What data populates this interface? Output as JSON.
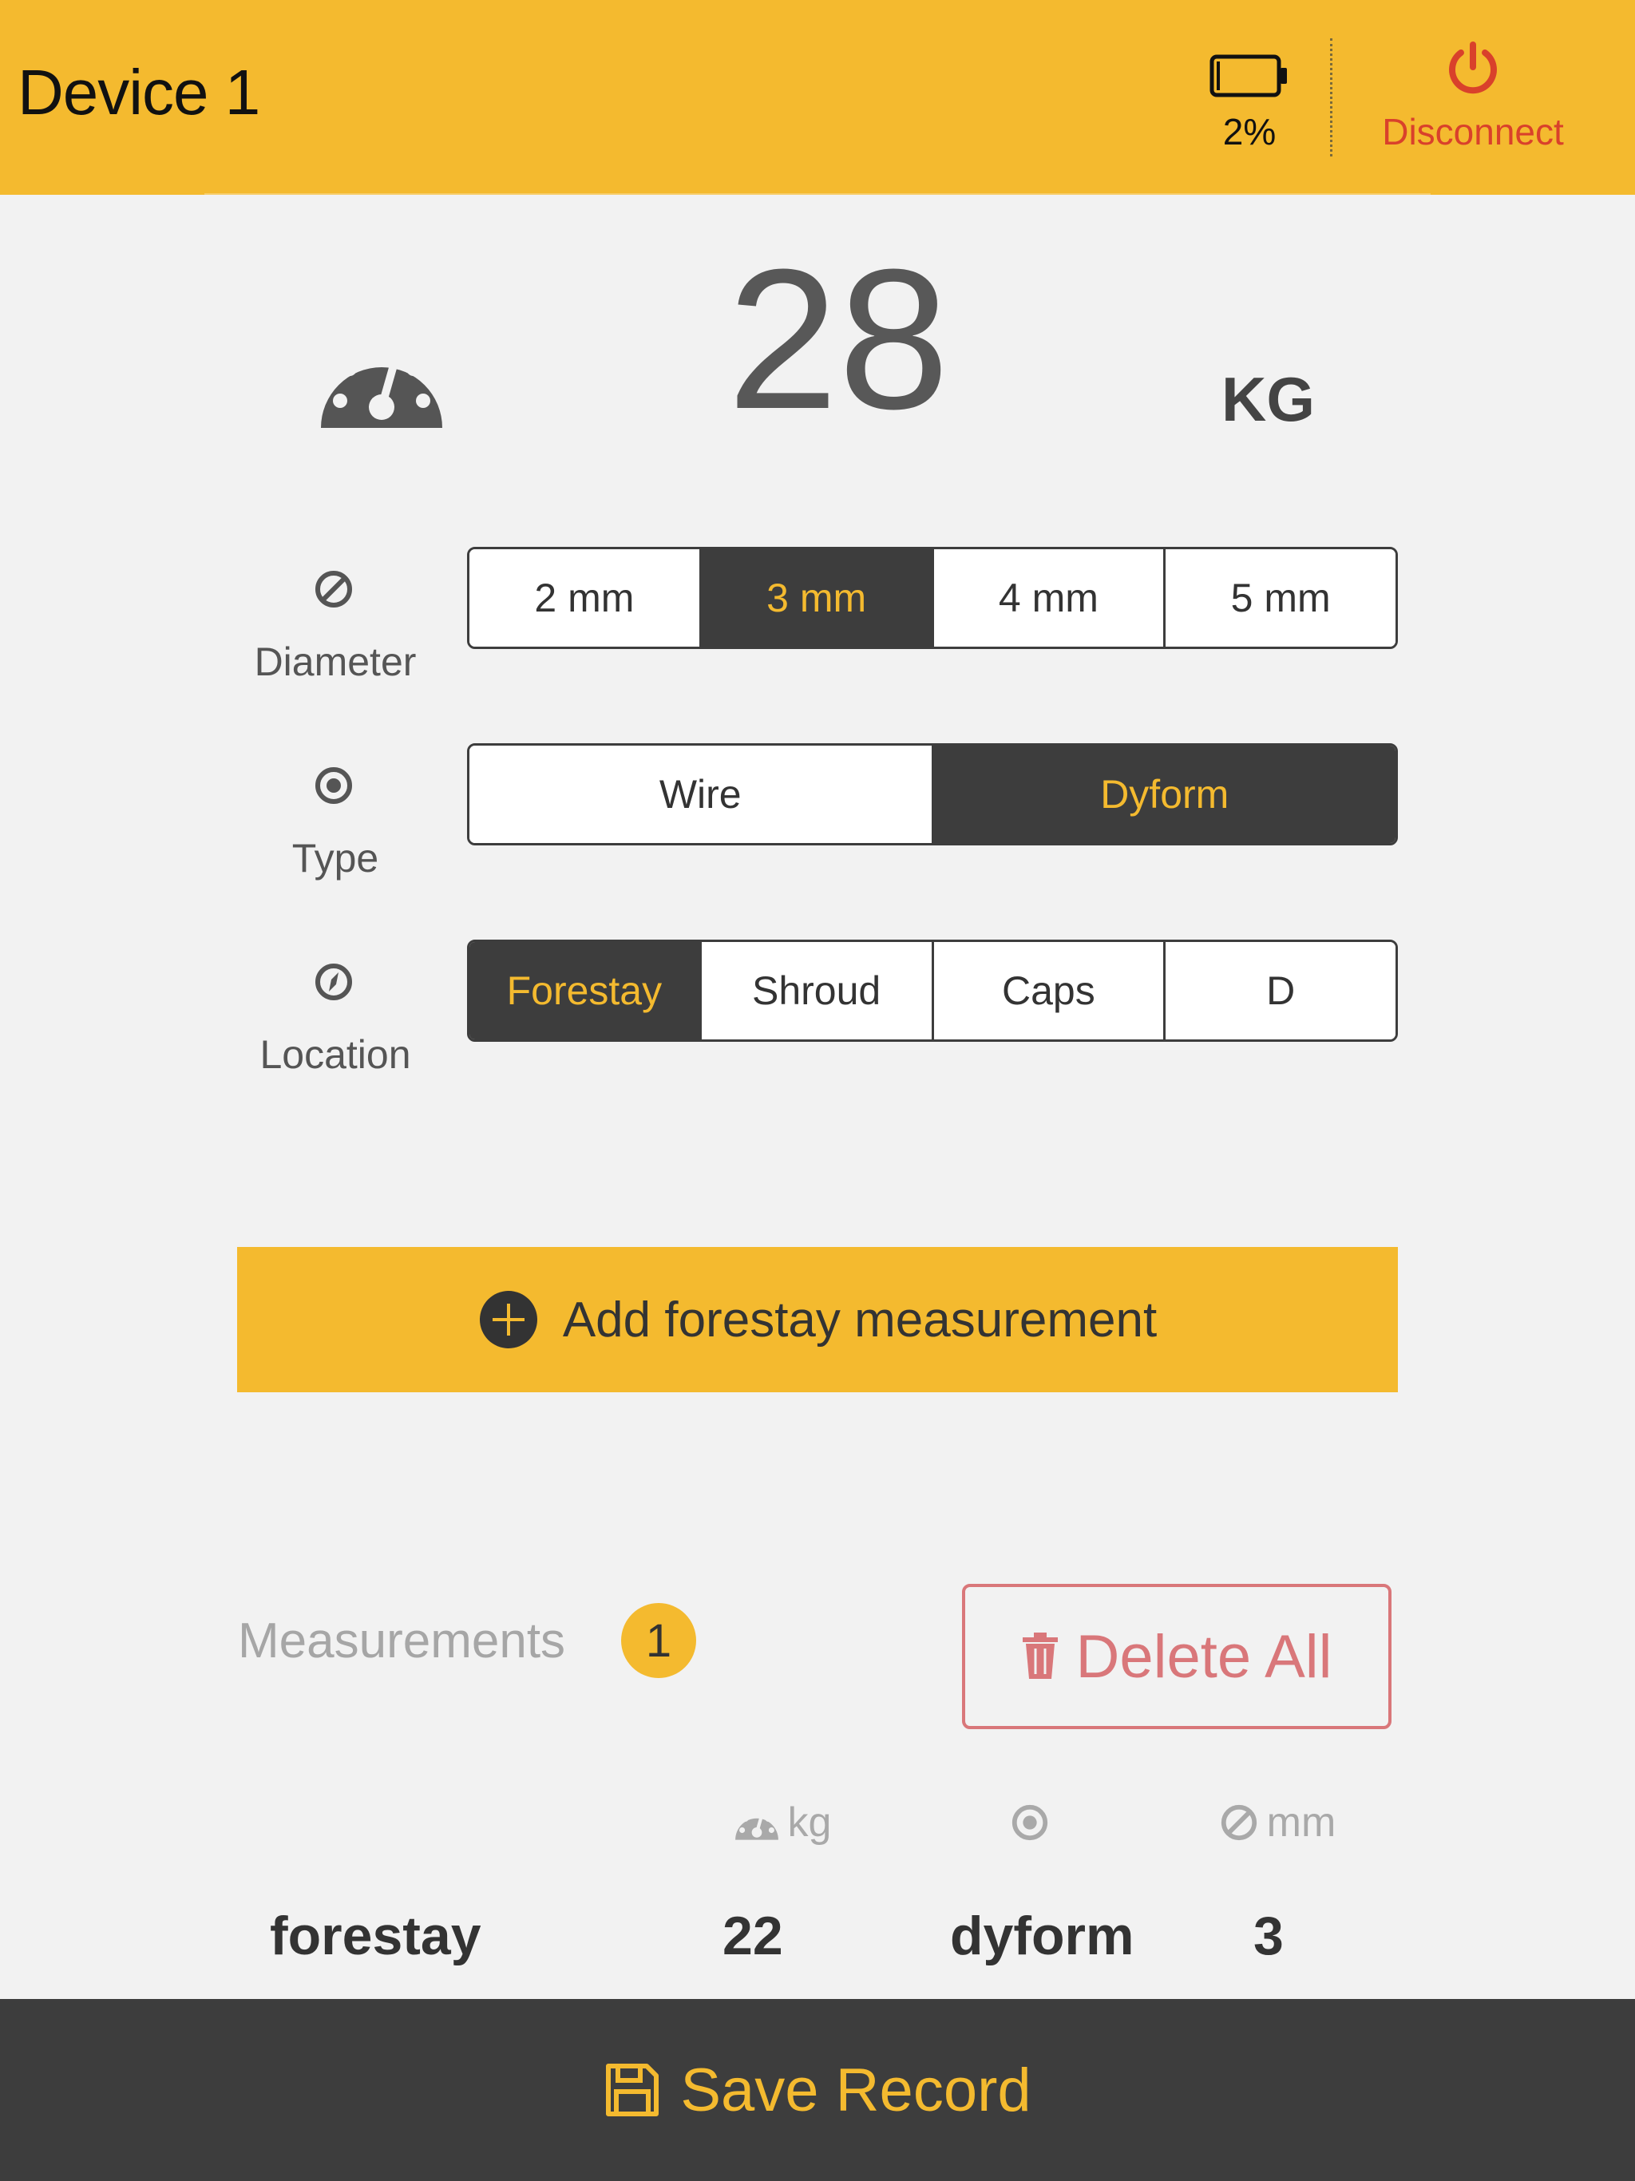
{
  "header": {
    "title": "Device 1",
    "battery_percent": "2%",
    "disconnect_label": "Disconnect"
  },
  "reading": {
    "value": "28",
    "unit": "KG"
  },
  "diameter": {
    "label": "Diameter",
    "options": [
      "2 mm",
      "3 mm",
      "4 mm",
      "5 mm"
    ],
    "selected": "3 mm"
  },
  "type": {
    "label": "Type",
    "options": [
      "Wire",
      "Dyform"
    ],
    "selected": "Dyform"
  },
  "location": {
    "label": "Location",
    "options": [
      "Forestay",
      "Shroud",
      "Caps",
      "D"
    ],
    "selected": "Forestay"
  },
  "add_button": {
    "label": "Add forestay measurement"
  },
  "measurements": {
    "title": "Measurements",
    "count": "1",
    "delete_all_label": "Delete All",
    "columns": {
      "kg_label": "kg",
      "mm_label": "mm"
    },
    "rows": [
      {
        "location": "forestay",
        "kg": "22",
        "type": "dyform",
        "mm": "3"
      }
    ]
  },
  "footer": {
    "save_label": "Save Record"
  },
  "colors": {
    "accent": "#f4ba2f",
    "dark": "#3d3d3d",
    "danger": "#d9412b",
    "delete": "#d9777a"
  }
}
